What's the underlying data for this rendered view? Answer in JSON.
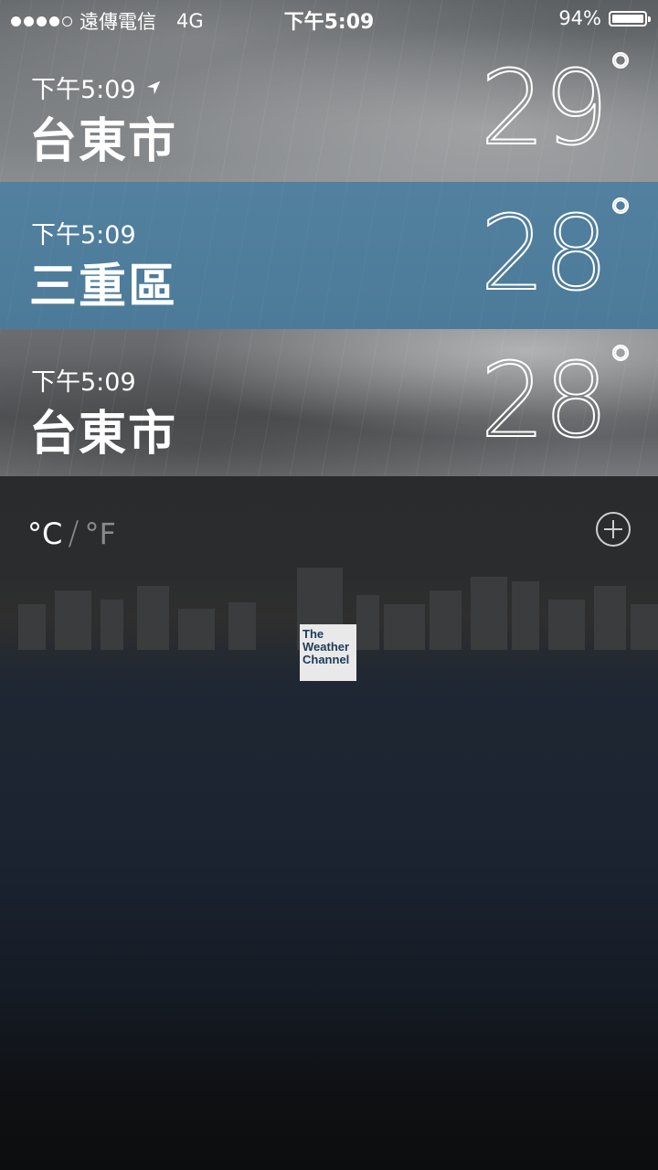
{
  "status_bar": {
    "carrier": "遠傳電信",
    "network": "4G",
    "time": "下午5:09",
    "battery_percent": "94%",
    "battery_level": 0.94,
    "signal_bars": 4,
    "signal_total": 5
  },
  "cities": [
    {
      "time": "下午5:09",
      "name": "台東市",
      "temp": "29",
      "degree": "°",
      "location_icon": "location-arrow-icon"
    },
    {
      "time": "下午5:09",
      "name": "三重區",
      "temp": "28",
      "degree": "°"
    },
    {
      "time": "下午5:09",
      "name": "台東市",
      "temp": "28",
      "degree": "°"
    }
  ],
  "footer": {
    "unit_c": "°C",
    "unit_slash": "/",
    "unit_f": "°F",
    "add_icon": "plus-circle-icon",
    "logo_lines": [
      "The",
      "Weather",
      "Channel"
    ]
  },
  "colors": {
    "selected_row": "#4f7d9c"
  }
}
